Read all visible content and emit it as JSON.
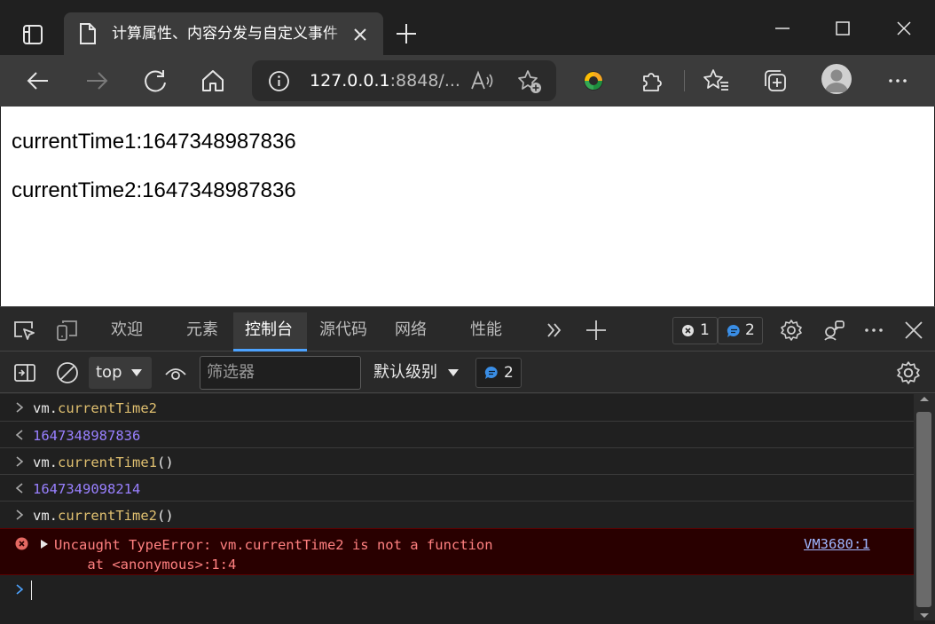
{
  "browser": {
    "tab": {
      "title": "计算属性、内容分发与自定义事件"
    },
    "address": {
      "url_host": "127.0.0.1",
      "url_rest": ":8848/..."
    }
  },
  "page": {
    "lines": [
      "currentTime1:1647348987836",
      "currentTime2:1647348987836"
    ]
  },
  "devtools": {
    "tabs": [
      {
        "label": "欢迎"
      },
      {
        "label": "元素"
      },
      {
        "label": "控制台",
        "active": true
      },
      {
        "label": "源代码"
      },
      {
        "label": "网络"
      },
      {
        "label": "性能"
      }
    ],
    "error_count": "1",
    "message_count": "2",
    "context": "top",
    "filter_placeholder": "筛选器",
    "level": "默认级别",
    "level_badge_count": "2"
  },
  "console": {
    "entries": [
      {
        "kind": "input",
        "obj": "vm.",
        "prop": "currentTime2",
        "suffix": ""
      },
      {
        "kind": "output",
        "value": "1647348987836"
      },
      {
        "kind": "input",
        "obj": "vm.",
        "prop": "currentTime1",
        "suffix": "()"
      },
      {
        "kind": "output",
        "value": "1647349098214"
      },
      {
        "kind": "input",
        "obj": "vm.",
        "prop": "currentTime2",
        "suffix": "()"
      }
    ],
    "error": {
      "message": "Uncaught TypeError: vm.currentTime2 is not a function",
      "stack": "    at <anonymous>:1:4",
      "source": "VM3680:1"
    }
  },
  "colors": {
    "accent": "#4da3ff",
    "error_text": "#ff8080",
    "error_bg": "#290000",
    "number": "#9980ff",
    "property": "#e0c070"
  },
  "icons": [
    "tab-actions-icon",
    "page-icon",
    "close-icon",
    "plus-icon",
    "minimize-icon",
    "maximize-icon",
    "back-icon",
    "forward-icon",
    "refresh-icon",
    "home-icon",
    "info-icon",
    "read-aloud-icon",
    "add-favorite-icon",
    "extension-icon",
    "puzzle-icon",
    "favorites-icon",
    "collections-icon",
    "profile-icon",
    "more-icon",
    "inspect-icon",
    "device-icon",
    "more-tabs-icon",
    "gear-icon",
    "customize-icon",
    "sidebar-toggle-icon",
    "clear-console-icon",
    "eye-icon",
    "error-icon",
    "message-icon"
  ]
}
